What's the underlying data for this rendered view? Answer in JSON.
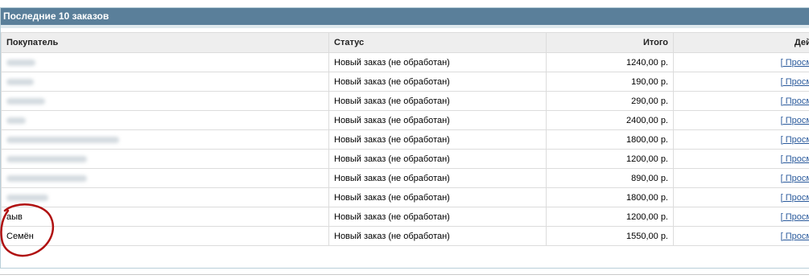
{
  "panel": {
    "title": "Последние 10 заказов"
  },
  "table": {
    "headers": {
      "customer": "Покупатель",
      "status": "Статус",
      "total": "Итого",
      "action": "Действ"
    },
    "rows": [
      {
        "customer": "",
        "status": "Новый заказ (не обработан)",
        "total": "1240,00 р.",
        "action": "[ Просмотр"
      },
      {
        "customer": "",
        "status": "Новый заказ (не обработан)",
        "total": "190,00 р.",
        "action": "[ Просмотр"
      },
      {
        "customer": "",
        "status": "Новый заказ (не обработан)",
        "total": "290,00 р.",
        "action": "[ Просмотр"
      },
      {
        "customer": "",
        "status": "Новый заказ (не обработан)",
        "total": "2400,00 р.",
        "action": "[ Просмотр"
      },
      {
        "customer": "",
        "status": "Новый заказ (не обработан)",
        "total": "1800,00 р.",
        "action": "[ Просмотр"
      },
      {
        "customer": "",
        "status": "Новый заказ (не обработан)",
        "total": "1200,00 р.",
        "action": "[ Просмотр"
      },
      {
        "customer": "",
        "status": "Новый заказ (не обработан)",
        "total": "890,00 р.",
        "action": "[ Просмотр"
      },
      {
        "customer": "",
        "status": "Новый заказ (не обработан)",
        "total": "1800,00 р.",
        "action": "[ Просмотр"
      },
      {
        "customer": "аыв",
        "status": "Новый заказ (не обработан)",
        "total": "1200,00 р.",
        "action": "[ Просмотр"
      },
      {
        "customer": "Семён",
        "status": "Новый заказ (не обработан)",
        "total": "1550,00 р.",
        "action": "[ Просмотр"
      }
    ]
  },
  "colors": {
    "header_bg": "#5a7f9a",
    "link": "#2a5a9c",
    "annotation": "#b01010"
  }
}
